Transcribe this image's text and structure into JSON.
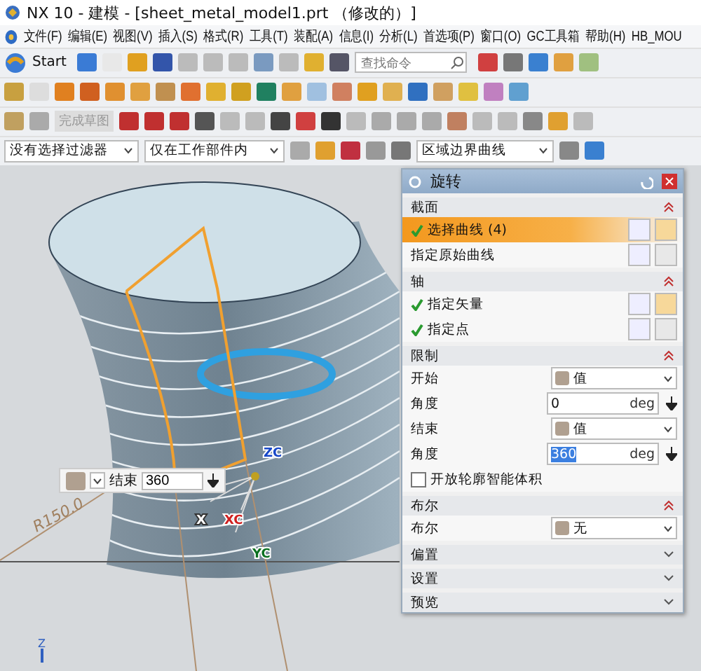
{
  "window": {
    "title": "NX 10 - 建模 - [sheet_metal_model1.prt （修改的）]"
  },
  "menu_bar": {
    "items": [
      "文件(F)",
      "编辑(E)",
      "视图(V)",
      "插入(S)",
      "格式(R)",
      "工具(T)",
      "装配(A)",
      "信息(I)",
      "分析(L)",
      "首选项(P)",
      "窗口(O)",
      "GC工具箱",
      "帮助(H)",
      "HB_MOU"
    ]
  },
  "standard_toolbar": {
    "start_label": "Start",
    "search": {
      "placeholder": "查找命令"
    }
  },
  "sketch_toolbar": {
    "finish_sketch": {
      "label": "完成草图",
      "disabled": true
    }
  },
  "selection_bar": {
    "filters": [
      {
        "value": "没有选择过滤器"
      },
      {
        "value": "仅在工作部件内"
      }
    ],
    "curve_rule": {
      "value": "区域边界曲线"
    }
  },
  "dialog": {
    "title": "旋转",
    "sections": [
      {
        "title": "截面",
        "expanded": true,
        "rows": [
          {
            "kind": "select",
            "label": "选择曲线 (4)",
            "checked": true,
            "selected": true
          },
          {
            "kind": "plain",
            "label": "指定原始曲线"
          }
        ]
      },
      {
        "title": "轴",
        "expanded": true,
        "rows": [
          {
            "kind": "select",
            "label": "指定矢量",
            "checked": true,
            "selected": false
          },
          {
            "kind": "select",
            "label": "指定点",
            "checked": true,
            "selected": false
          }
        ]
      },
      {
        "title": "限制",
        "expanded": true,
        "rows": [
          {
            "kind": "dropdown",
            "label": "开始",
            "value": "值"
          },
          {
            "kind": "number",
            "label": "角度",
            "value": "0",
            "unit": "deg",
            "selected": false
          },
          {
            "kind": "dropdown",
            "label": "结束",
            "value": "值"
          },
          {
            "kind": "number",
            "label": "角度",
            "value": "360",
            "unit": "deg",
            "selected": true
          },
          {
            "kind": "checkbox",
            "label": "开放轮廓智能体积",
            "checked": false
          }
        ]
      },
      {
        "title": "布尔",
        "expanded": true,
        "rows": [
          {
            "kind": "dropdown",
            "label": "布尔",
            "value": "无"
          }
        ]
      },
      {
        "title": "偏置",
        "expanded": false
      },
      {
        "title": "设置",
        "expanded": false
      },
      {
        "title": "预览",
        "expanded": false
      }
    ]
  },
  "viewport": {
    "floating_input": {
      "label": "结束",
      "value": "360"
    },
    "dimension": "R150.0",
    "axis_labels": [
      "ZC",
      "XC",
      "YC",
      "X"
    ],
    "triad_label": "Z"
  }
}
